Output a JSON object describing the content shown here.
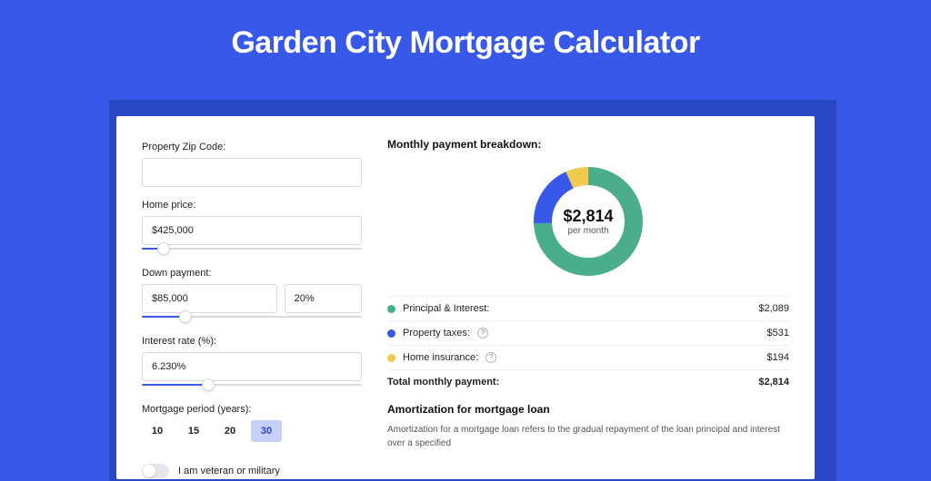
{
  "colors": {
    "accent": "#3858e9",
    "green": "#4aae8c",
    "yellow": "#f2c94c"
  },
  "title": "Garden City Mortgage Calculator",
  "form": {
    "zip_label": "Property Zip Code:",
    "zip_value": "",
    "home_price_label": "Home price:",
    "home_price_value": "$425,000",
    "home_price_slider_pct": 10,
    "down_payment_label": "Down payment:",
    "down_payment_value": "$85,000",
    "down_payment_pct_value": "20%",
    "down_payment_slider_pct": 20,
    "interest_label": "Interest rate (%):",
    "interest_value": "6.230%",
    "interest_slider_pct": 30,
    "period_label": "Mortgage period (years):",
    "period_options": [
      "10",
      "15",
      "20",
      "30"
    ],
    "period_selected": "30",
    "veteran_label": "I am veteran or military",
    "veteran_on": false
  },
  "breakdown": {
    "title": "Monthly payment breakdown:",
    "total_big": "$2,814",
    "per_month": "per month",
    "rows": [
      {
        "label": "Principal & Interest:",
        "value": "$2,089",
        "dot": "green",
        "help": false
      },
      {
        "label": "Property taxes:",
        "value": "$531",
        "dot": "blue",
        "help": true
      },
      {
        "label": "Home insurance:",
        "value": "$194",
        "dot": "yellow",
        "help": true
      }
    ],
    "total_label": "Total monthly payment:",
    "total_value": "$2,814"
  },
  "chart_data": {
    "type": "pie",
    "title": "Monthly payment breakdown:",
    "categories": [
      "Principal & Interest",
      "Property taxes",
      "Home insurance"
    ],
    "values": [
      2089,
      531,
      194
    ],
    "colors": [
      "#4aae8c",
      "#3858e9",
      "#f2c94c"
    ],
    "total": 2814,
    "center_label": "$2,814 per month"
  },
  "amortization": {
    "title": "Amortization for mortgage loan",
    "text": "Amortization for a mortgage loan refers to the gradual repayment of the loan principal and interest over a specified"
  }
}
